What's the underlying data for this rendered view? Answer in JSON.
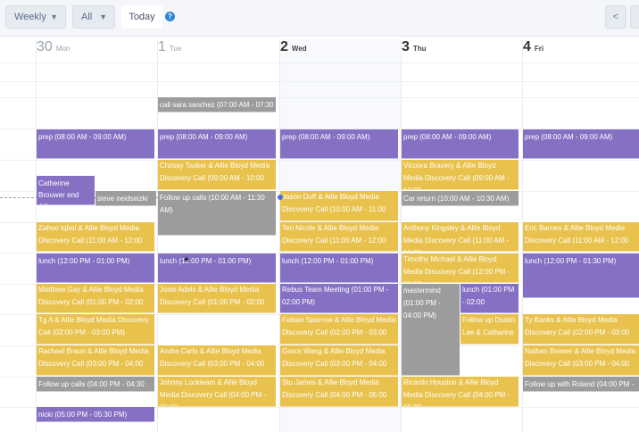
{
  "toolbar": {
    "view_select": "Weekly",
    "filter_select": "All",
    "today_label": "Today",
    "help_icon": "help-icon",
    "prev_label": "<",
    "next_label": ""
  },
  "days": [
    {
      "num": "30",
      "name": "Mon"
    },
    {
      "num": "1",
      "name": "Tue"
    },
    {
      "num": "2",
      "name": "Wed"
    },
    {
      "num": "3",
      "name": "Thu"
    },
    {
      "num": "4",
      "name": "Fri"
    }
  ],
  "events": {
    "mon": [
      "prep (08:00 AM - 09:00 AM)",
      "Catherine Brouwer and Allie",
      "steve neidseizki",
      "Zahoo Iqbal & Allie Bloyd Media Discovery Call (11:00 AM - 12:00",
      "lunch (12:00 PM - 01:00 PM)",
      "Matthew Gay & Allie Bloyd Media Discovery Call (01:00 PM - 02:00",
      "Tg A & Allie Bloyd Media Discovery Call (02:00 PM - 03:00 PM)",
      "Rachael Braun & Allie Bloyd Media Discovery Call (03:00 PM - 04:00",
      "Follow up calls (04:00 PM - 04:30",
      "nicki (05:00 PM - 05:30 PM)"
    ],
    "tue": [
      "call sara sanchez (07:00 AM - 07:30",
      "prep (08:00 AM - 09:00 AM)",
      "Chrissy Tasker & Allie Bloyd Media Discovery Call (09:00 AM - 10:00",
      "Follow up calls (10:00 AM - 11:30 AM)",
      "lunch (12:00 PM - 01:00 PM)",
      "Josie Adels & Allie Bloyd Media Discovery Call (01:00 PM - 02:00",
      "Andra Carlo & Allie Bloyd Media Discovery Call (03:00 PM - 04:00",
      "Johnny Lockleam & Allie Bloyd Media Discovery Call (04:00 PM - 05:00"
    ],
    "wed": [
      "prep (08:00 AM - 09:00 AM)",
      "Jason Duff & Allie Bloyd Media Discovery Call (10:00 AM - 11:00",
      "Teri Nicole & Allie Bloyd Media Discovery Call (11:00 AM - 12:00",
      "lunch (12:00 PM - 01:00 PM)",
      "Rebus Team Meeting (01:00 PM - 02:00 PM)",
      "Fabian Sparrow & Allie Bloyd Media Discovery Call (02:00 PM - 03:00",
      "Grace Wang & Allie Bloyd Media Discovery Call (03:00 PM - 04:00",
      "Stu James & Allie Bloyd Media Discovery Call (04:00 PM - 05:00"
    ],
    "thu": [
      "prep (08:00 AM - 09:00 AM)",
      "Vicoora Bravery & Allie Bloyd Media Discovery Call (09:00 AM - 10:00",
      "Car return (10:00 AM - 10:30 AM)",
      "Anthony Kingsley & Allie Bloyd Media Discovery Call (11:00 AM - 12:00",
      "Timothy Michael & Allie Bloyd Media Discovery Call (12:00 PM - 01:00",
      "mastermind (01:00 PM - 04:00 PM)",
      "lunch (01:00 PM - 02:00",
      "Follow up Dustin Lee & Catharine",
      "Ricardo Houston & Allie Bloyd Media Discovery Call (04:00 PM - 05:00"
    ],
    "fri": [
      "prep (08:00 AM - 09:00 AM)",
      "Eric Barnes & Allie Bloyd Media Discovery Call (11:00 AM - 12:00",
      "lunch (12:00 PM - 01:30 PM)",
      "Ty Banks & Allie Bloyd Media Discovery Call (02:00 PM - 03:00",
      "Nathan Brewer & Allie Bloyd Media Discovery Call (03:00 PM - 04:00",
      "Follow up with Roland (04:00 PM - 05:00"
    ]
  },
  "colors": {
    "purple": "#8570c4",
    "yellow": "#e9c24d",
    "gray": "#9c9c9c",
    "accent": "#2f86d6"
  }
}
